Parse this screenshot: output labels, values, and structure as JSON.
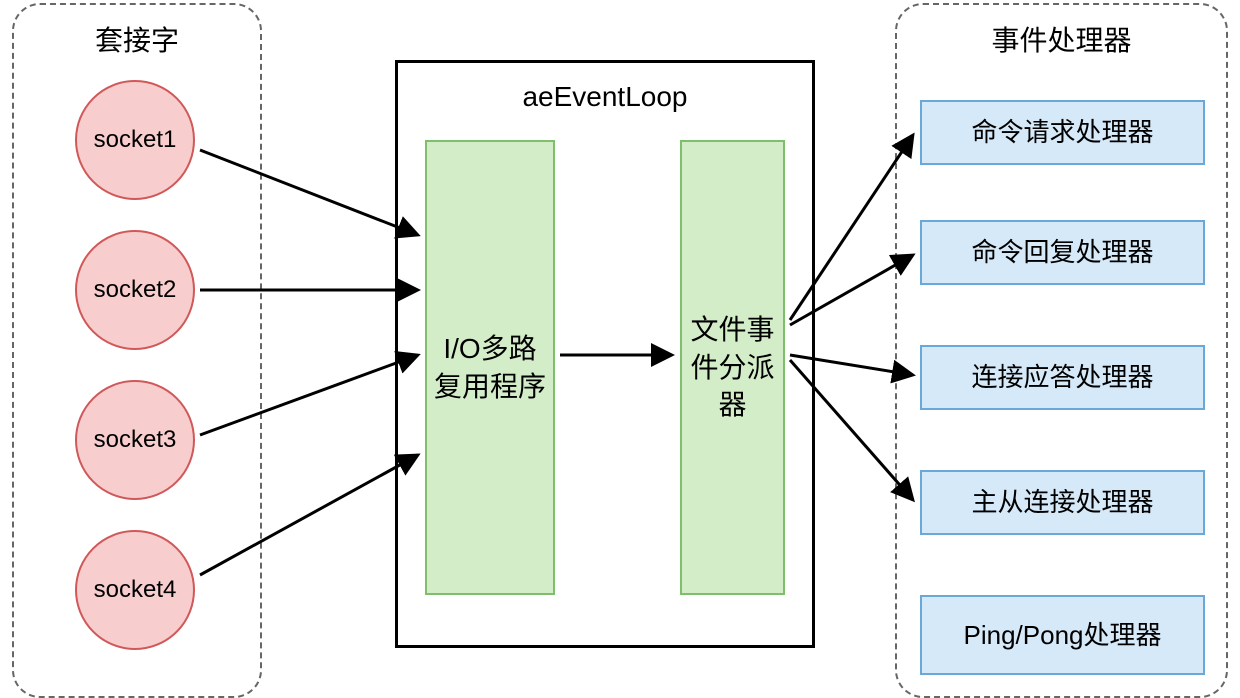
{
  "sockets": {
    "title": "套接字",
    "items": [
      "socket1",
      "socket2",
      "socket3",
      "socket4"
    ]
  },
  "eventLoop": {
    "title": "aeEventLoop",
    "ioMultiplex": "I/O多路复用程序",
    "dispatcher": "文件事件分派器"
  },
  "handlers": {
    "title": "事件处理器",
    "items": [
      "命令请求处理器",
      "命令回复处理器",
      "连接应答处理器",
      "主从连接处理器",
      "Ping/Pong处理器"
    ]
  }
}
